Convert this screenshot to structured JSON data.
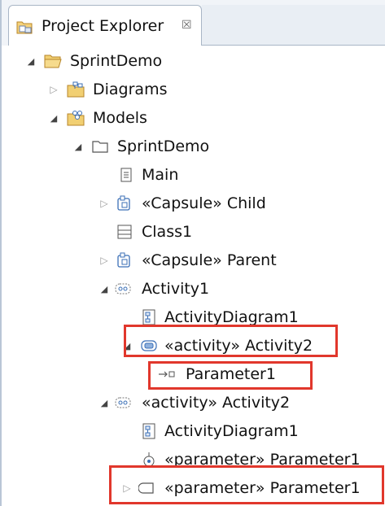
{
  "view": {
    "title": "Project Explorer",
    "close_glyph": "☒"
  },
  "tree": {
    "sprintdemo_project": {
      "label": "SprintDemo",
      "icon": "open-folder-icon",
      "expanded": true
    },
    "diagrams": {
      "label": "Diagrams",
      "icon": "diagrams-folder-icon",
      "expanded": false
    },
    "models": {
      "label": "Models",
      "icon": "models-folder-icon",
      "expanded": true
    },
    "sprintdemo_package": {
      "label": "SprintDemo",
      "icon": "package-icon",
      "expanded": true
    },
    "main": {
      "label": "Main",
      "icon": "diagram-page-icon"
    },
    "capsule_child": {
      "label": "«Capsule» Child",
      "icon": "capsule-icon",
      "expanded": false
    },
    "class1": {
      "label": "Class1",
      "icon": "class-icon"
    },
    "capsule_parent": {
      "label": "«Capsule» Parent",
      "icon": "capsule-icon",
      "expanded": false
    },
    "activity1": {
      "label": "Activity1",
      "icon": "activity-icon",
      "expanded": true
    },
    "activitydiagram1_a": {
      "label": "ActivityDiagram1",
      "icon": "activity-diagram-icon"
    },
    "activity2_nested": {
      "label": "«activity» Activity2",
      "icon": "activity-node-icon",
      "expanded": true
    },
    "parameter1_nested": {
      "label": "Parameter1",
      "icon": "parameter-pin-icon"
    },
    "activity2": {
      "label": "«activity» Activity2",
      "icon": "activity-icon",
      "expanded": true
    },
    "activitydiagram1_b": {
      "label": "ActivityDiagram1",
      "icon": "activity-diagram-icon"
    },
    "parameter_node": {
      "label": "«parameter» Parameter1",
      "icon": "parameter-node-icon"
    },
    "parameter_item": {
      "label": "«parameter» Parameter1",
      "icon": "parameter-icon",
      "expanded": false
    }
  },
  "glyphs": {
    "expanded": "◢",
    "collapsed": "▷"
  },
  "colors": {
    "highlight": "#e1372c",
    "folder": "#e7b84a",
    "icon_blue": "#3b6fb6"
  }
}
